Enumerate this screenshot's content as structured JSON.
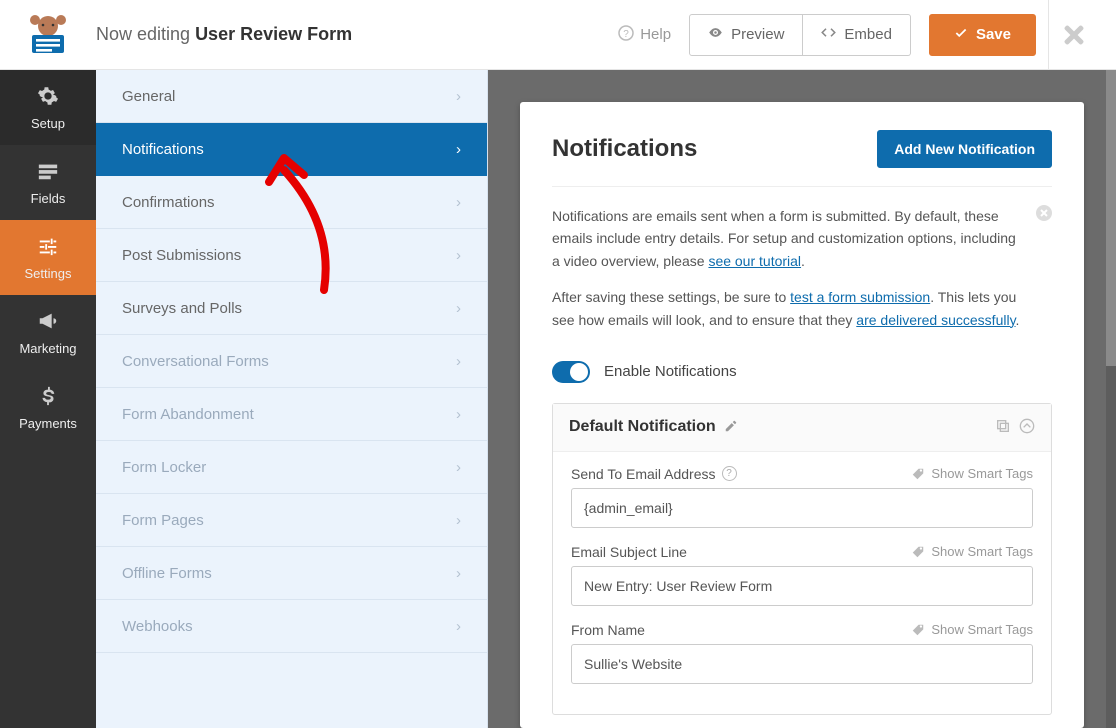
{
  "topbar": {
    "editing_prefix": "Now editing ",
    "form_name": "User Review Form",
    "help": "Help",
    "preview": "Preview",
    "embed": "Embed",
    "save": "Save"
  },
  "rail": {
    "setup": "Setup",
    "fields": "Fields",
    "settings": "Settings",
    "marketing": "Marketing",
    "payments": "Payments"
  },
  "settings_menu": [
    {
      "key": "general",
      "label": "General",
      "active": false,
      "disabled": false
    },
    {
      "key": "notifications",
      "label": "Notifications",
      "active": true,
      "disabled": false
    },
    {
      "key": "confirmations",
      "label": "Confirmations",
      "active": false,
      "disabled": false
    },
    {
      "key": "post_submissions",
      "label": "Post Submissions",
      "active": false,
      "disabled": false
    },
    {
      "key": "surveys_polls",
      "label": "Surveys and Polls",
      "active": false,
      "disabled": false
    },
    {
      "key": "conversational",
      "label": "Conversational Forms",
      "active": false,
      "disabled": true
    },
    {
      "key": "abandonment",
      "label": "Form Abandonment",
      "active": false,
      "disabled": true
    },
    {
      "key": "locker",
      "label": "Form Locker",
      "active": false,
      "disabled": true
    },
    {
      "key": "pages",
      "label": "Form Pages",
      "active": false,
      "disabled": true
    },
    {
      "key": "offline",
      "label": "Offline Forms",
      "active": false,
      "disabled": true
    },
    {
      "key": "webhooks",
      "label": "Webhooks",
      "active": false,
      "disabled": true
    }
  ],
  "panel": {
    "title": "Notifications",
    "add_new": "Add New Notification",
    "desc_intro": "Notifications are emails sent when a form is submitted. By default, these emails include entry details. For setup and customization options, including a video overview, please ",
    "desc_tutorial_link": "see our tutorial",
    "desc_after": "After saving these settings, be sure to ",
    "desc_test_link": "test a form submission",
    "desc_after2": ". This lets you see how emails will look, and to ensure that they ",
    "desc_delivered_link": "are delivered successfully",
    "enable_label": "Enable Notifications",
    "default_title": "Default Notification",
    "smart_tags": "Show Smart Tags",
    "fields": {
      "send_to": {
        "label": "Send To Email Address",
        "value": "{admin_email}"
      },
      "subject": {
        "label": "Email Subject Line",
        "value": "New Entry: User Review Form"
      },
      "from_name": {
        "label": "From Name",
        "value": "Sullie's Website"
      }
    }
  }
}
